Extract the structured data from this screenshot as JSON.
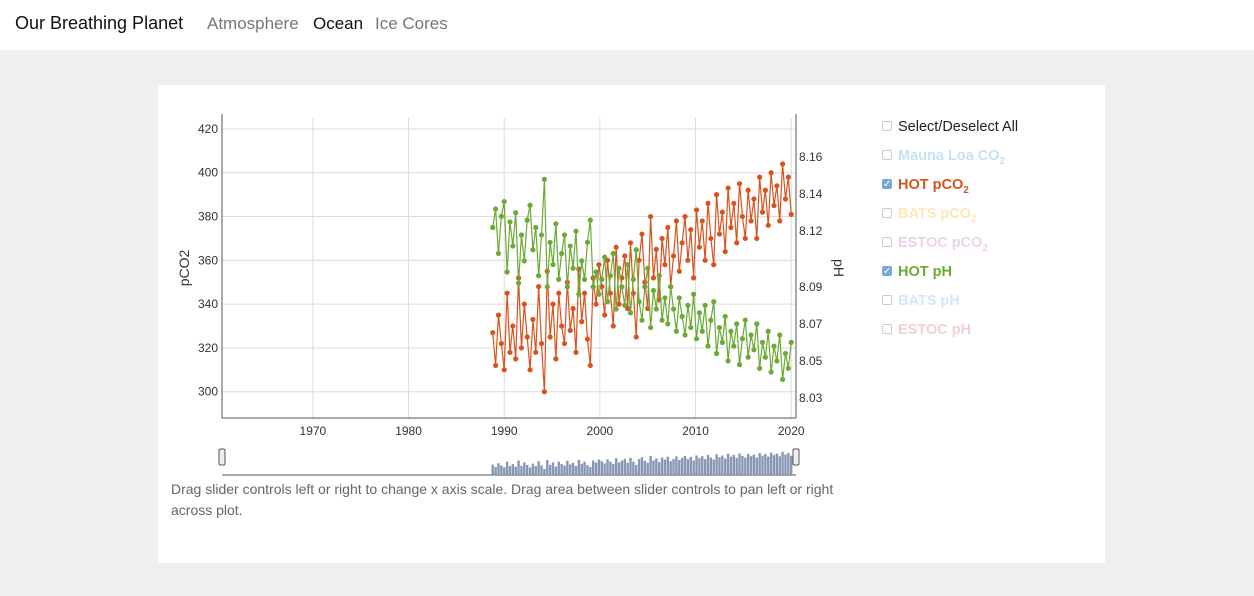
{
  "header": {
    "brand": "Our Breathing Planet",
    "nav": [
      {
        "label": "Atmosphere",
        "active": false
      },
      {
        "label": "Ocean",
        "active": true
      },
      {
        "label": "Ice Cores",
        "active": false
      }
    ]
  },
  "legend": {
    "select_all": "Select/Deselect All",
    "items": [
      {
        "label": "Mauna Loa CO",
        "sub": "2",
        "checked": false,
        "color": "#c7e1f4"
      },
      {
        "label": "HOT pCO",
        "sub": "2",
        "checked": true,
        "color": "#d9531e"
      },
      {
        "label": "BATS pCO",
        "sub": "2",
        "checked": false,
        "color": "#fde7b8"
      },
      {
        "label": "ESTOC pCO",
        "sub": "2",
        "checked": false,
        "color": "#e8d3ea"
      },
      {
        "label": "HOT pH",
        "sub": "",
        "checked": true,
        "color": "#6aaa35"
      },
      {
        "label": "BATS pH",
        "sub": "",
        "checked": false,
        "color": "#cfe9f6"
      },
      {
        "label": "ESTOC pH",
        "sub": "",
        "checked": false,
        "color": "#f3d0d0"
      }
    ]
  },
  "help_text": "Drag slider controls left or right to change x axis scale. Drag area between slider controls to pan left or right across plot.",
  "chart_data": {
    "type": "line",
    "xlabel": "",
    "ylabel": "pCO2",
    "y2label": "pH",
    "xlim": [
      1960.5,
      2020.5
    ],
    "ylim": [
      288,
      425
    ],
    "y2lim": [
      8.0192,
      8.1811
    ],
    "x_ticks": [
      1970,
      1980,
      1990,
      2000,
      2010,
      2020
    ],
    "y_ticks": [
      300,
      320,
      340,
      360,
      380,
      400,
      420
    ],
    "y2_ticks": [
      "8.03",
      "8.05",
      "8.07",
      "8.09",
      "8.12",
      "8.14",
      "8.16"
    ],
    "y2_tick_values": [
      8.03,
      8.05,
      8.07,
      8.09,
      8.12,
      8.14,
      8.16
    ],
    "grid": true,
    "series": [
      {
        "name": "HOT pCO2",
        "axis": "left",
        "color": "#d9531e",
        "x": [
          1988.8,
          1989.1,
          1989.4,
          1989.7,
          1990.0,
          1990.3,
          1990.6,
          1990.9,
          1991.2,
          1991.5,
          1991.8,
          1992.1,
          1992.4,
          1992.7,
          1993.0,
          1993.3,
          1993.6,
          1993.9,
          1994.2,
          1994.5,
          1994.8,
          1995.1,
          1995.4,
          1995.7,
          1996.0,
          1996.3,
          1996.6,
          1996.9,
          1997.2,
          1997.5,
          1997.8,
          1998.1,
          1998.4,
          1998.7,
          1999.0,
          1999.3,
          1999.6,
          1999.9,
          2000.2,
          2000.5,
          2000.8,
          2001.1,
          2001.4,
          2001.7,
          2002.0,
          2002.3,
          2002.6,
          2002.9,
          2003.2,
          2003.5,
          2003.8,
          2004.1,
          2004.4,
          2004.7,
          2005.0,
          2005.3,
          2005.6,
          2005.9,
          2006.2,
          2006.5,
          2006.8,
          2007.1,
          2007.4,
          2007.7,
          2008.0,
          2008.3,
          2008.6,
          2008.9,
          2009.2,
          2009.5,
          2009.8,
          2010.1,
          2010.4,
          2010.7,
          2011.0,
          2011.3,
          2011.6,
          2011.9,
          2012.2,
          2012.5,
          2012.8,
          2013.1,
          2013.4,
          2013.7,
          2014.0,
          2014.3,
          2014.6,
          2014.9,
          2015.2,
          2015.5,
          2015.8,
          2016.1,
          2016.4,
          2016.7,
          2017.0,
          2017.3,
          2017.6,
          2017.9,
          2018.2,
          2018.5,
          2018.8,
          2019.1,
          2019.4,
          2019.7,
          2020.0
        ],
        "values": [
          327,
          312,
          335,
          322,
          310,
          345,
          318,
          330,
          315,
          352,
          320,
          340,
          325,
          310,
          333,
          318,
          348,
          322,
          300,
          355,
          325,
          340,
          315,
          345,
          330,
          322,
          350,
          328,
          338,
          318,
          356,
          332,
          345,
          324,
          312,
          352,
          340,
          358,
          348,
          335,
          360,
          345,
          330,
          366,
          340,
          352,
          362,
          338,
          368,
          345,
          325,
          360,
          372,
          350,
          338,
          380,
          352,
          365,
          342,
          370,
          358,
          375,
          348,
          362,
          378,
          355,
          368,
          380,
          360,
          374,
          352,
          383,
          366,
          378,
          360,
          386,
          370,
          358,
          390,
          372,
          382,
          364,
          393,
          375,
          386,
          368,
          395,
          380,
          370,
          392,
          378,
          388,
          370,
          398,
          382,
          392,
          376,
          400,
          385,
          394,
          378,
          404,
          388,
          398,
          381
        ]
      },
      {
        "name": "HOT pH",
        "axis": "right",
        "color": "#6aaa35",
        "x": [
          1988.8,
          1989.1,
          1989.4,
          1989.7,
          1990.0,
          1990.3,
          1990.6,
          1990.9,
          1991.2,
          1991.5,
          1991.8,
          1992.1,
          1992.4,
          1992.7,
          1993.0,
          1993.3,
          1993.6,
          1993.9,
          1994.2,
          1994.5,
          1994.8,
          1995.1,
          1995.4,
          1995.7,
          1996.0,
          1996.3,
          1996.6,
          1996.9,
          1997.2,
          1997.5,
          1997.8,
          1998.1,
          1998.4,
          1998.7,
          1999.0,
          1999.3,
          1999.6,
          1999.9,
          2000.2,
          2000.5,
          2000.8,
          2001.1,
          2001.4,
          2001.7,
          2002.0,
          2002.3,
          2002.6,
          2002.9,
          2003.2,
          2003.5,
          2003.8,
          2004.1,
          2004.4,
          2004.7,
          2005.0,
          2005.3,
          2005.6,
          2005.9,
          2006.2,
          2006.5,
          2006.8,
          2007.1,
          2007.4,
          2007.7,
          2008.0,
          2008.3,
          2008.6,
          2008.9,
          2009.2,
          2009.5,
          2009.8,
          2010.1,
          2010.4,
          2010.7,
          2011.0,
          2011.3,
          2011.6,
          2011.9,
          2012.2,
          2012.5,
          2012.8,
          2013.1,
          2013.4,
          2013.7,
          2014.0,
          2014.3,
          2014.6,
          2014.9,
          2015.2,
          2015.5,
          2015.8,
          2016.1,
          2016.4,
          2016.7,
          2017.0,
          2017.3,
          2017.6,
          2017.9,
          2018.2,
          2018.5,
          2018.8,
          2019.1,
          2019.4,
          2019.7,
          2020.0
        ],
        "values": [
          8.122,
          8.132,
          8.108,
          8.128,
          8.136,
          8.098,
          8.125,
          8.112,
          8.13,
          8.092,
          8.118,
          8.104,
          8.126,
          8.134,
          8.11,
          8.122,
          8.096,
          8.118,
          8.148,
          8.09,
          8.114,
          8.102,
          8.124,
          8.094,
          8.108,
          8.118,
          8.09,
          8.112,
          8.1,
          8.12,
          8.086,
          8.104,
          8.094,
          8.114,
          8.126,
          8.09,
          8.098,
          8.086,
          8.094,
          8.106,
          8.082,
          8.096,
          8.108,
          8.078,
          8.1,
          8.09,
          8.08,
          8.102,
          8.076,
          8.094,
          8.11,
          8.082,
          8.072,
          8.09,
          8.1,
          8.068,
          8.088,
          8.078,
          8.096,
          8.072,
          8.084,
          8.07,
          8.09,
          8.078,
          8.066,
          8.084,
          8.074,
          8.064,
          8.08,
          8.068,
          8.086,
          8.062,
          8.076,
          8.066,
          8.08,
          8.058,
          8.072,
          8.082,
          8.054,
          8.068,
          8.06,
          8.074,
          8.05,
          8.066,
          8.058,
          8.07,
          8.048,
          8.062,
          8.072,
          8.052,
          8.064,
          8.056,
          8.07,
          8.046,
          8.06,
          8.052,
          8.066,
          8.044,
          8.058,
          8.05,
          8.064,
          8.04,
          8.054,
          8.046,
          8.06
        ]
      }
    ]
  }
}
